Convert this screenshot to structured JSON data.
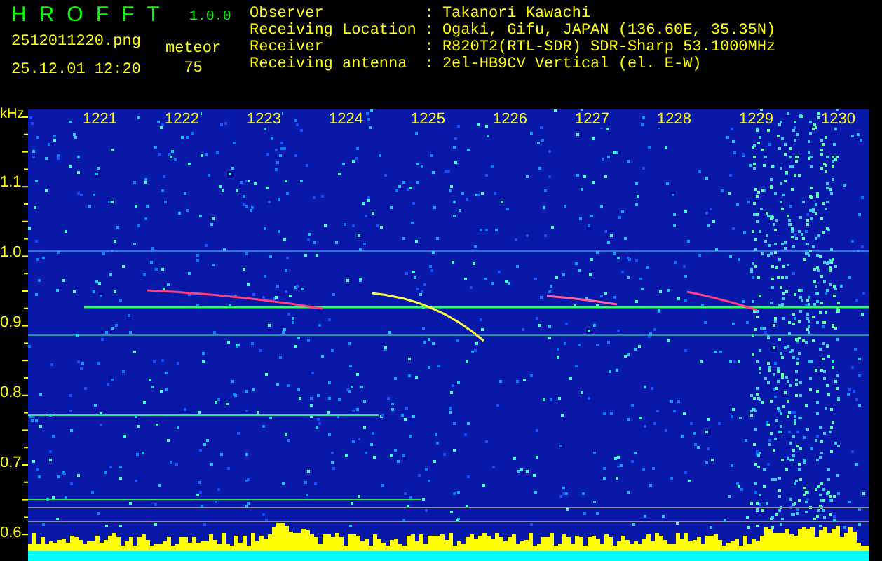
{
  "app": {
    "name": "HROFFT",
    "version": "1.0.0"
  },
  "file": {
    "name": "2512011220.png",
    "timestamp": "25.12.01 12:20"
  },
  "detection": {
    "label": "meteor",
    "count": "75"
  },
  "station": [
    {
      "label": "Observer",
      "separator": ":",
      "value": "Takanori Kawachi"
    },
    {
      "label": "Receiving Location",
      "separator": ":",
      "value": "Ogaki, Gifu, JAPAN (136.60E, 35.35N)"
    },
    {
      "label": "Receiver",
      "separator": ":",
      "value": "R820T2(RTL-SDR) SDR-Sharp 53.1000MHz"
    },
    {
      "label": "Receiving antenna",
      "separator": ":",
      "value": "2el-HB9CV Vertical (el. E-W)"
    }
  ],
  "spectrogram": {
    "y_unit": "kHz",
    "x_labels": [
      "1221",
      "1222",
      "1223",
      "1224",
      "1225",
      "1226",
      "1227",
      "1228",
      "1229",
      "1230"
    ],
    "y_labels": [
      "1.1",
      "1.0",
      "0.9",
      "0.8",
      "0.7",
      "0.6"
    ]
  }
}
